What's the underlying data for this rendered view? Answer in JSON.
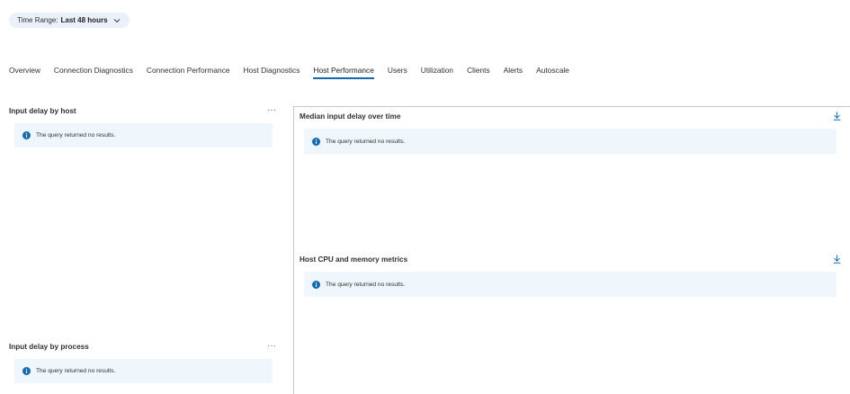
{
  "time_range": {
    "label": "Time Range:",
    "value": "Last 48 hours",
    "icon": "chevron-down-icon"
  },
  "tabs": [
    {
      "label": "Overview",
      "active": false
    },
    {
      "label": "Connection Diagnostics",
      "active": false
    },
    {
      "label": "Connection Performance",
      "active": false
    },
    {
      "label": "Host Diagnostics",
      "active": false
    },
    {
      "label": "Host Performance",
      "active": true
    },
    {
      "label": "Users",
      "active": false
    },
    {
      "label": "Utilization",
      "active": false
    },
    {
      "label": "Clients",
      "active": false
    },
    {
      "label": "Alerts",
      "active": false
    },
    {
      "label": "Autoscale",
      "active": false
    }
  ],
  "tiles": {
    "input_delay_by_host": {
      "title": "Input delay by host",
      "message": "The query returned no results."
    },
    "median_input_delay": {
      "title": "Median input delay over time",
      "message": "The query returned no results."
    },
    "host_cpu_memory": {
      "title": "Host CPU and memory metrics",
      "message": "The query returned no results."
    },
    "input_delay_by_process": {
      "title": "Input delay by process",
      "message": "The query returned no results."
    }
  },
  "more_glyph": "···",
  "colors": {
    "accent": "#0f6cbd",
    "notice_bg": "#eff6fc",
    "info_icon": "#0f6cbd"
  }
}
